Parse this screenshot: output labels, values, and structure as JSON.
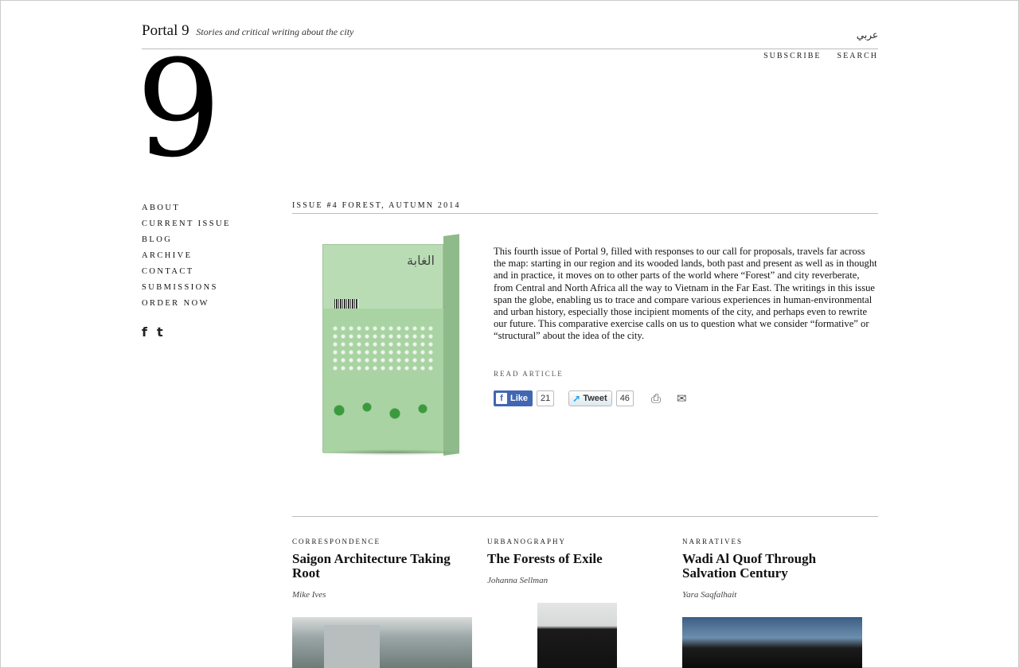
{
  "header": {
    "site_name": "Portal 9",
    "tagline": "Stories and critical writing about the city",
    "language_link": "عربي",
    "nav": [
      "SUBSCRIBE",
      "SEARCH"
    ],
    "logo_numeral": "9"
  },
  "sidebar": {
    "items": [
      {
        "label": "ABOUT"
      },
      {
        "label": "CURRENT ISSUE"
      },
      {
        "label": "BLOG"
      },
      {
        "label": "ARCHIVE"
      },
      {
        "label": "CONTACT"
      },
      {
        "label": "SUBMISSIONS"
      },
      {
        "label": "ORDER NOW"
      }
    ],
    "social": {
      "facebook": "f",
      "twitter": "t"
    }
  },
  "issue": {
    "heading": "ISSUE #4 FOREST, AUTUMN 2014",
    "book_title_arabic": "الغابة",
    "description": "This fourth issue of Portal 9, filled with responses to our call for proposals, travels far across the map: starting in our region and its wooded lands, both past and present as well as in thought and in practice, it moves on to other parts of the world where “Forest” and city reverberate, from Central and North Africa all the way to Vietnam in the Far East. The writings in this issue span the globe, enabling us to trace and compare various experiences in human-environmental and urban history, especially those incipient moments of the city, and perhaps even to rewrite our future. This comparative exercise calls on us to question what we consider “formative” or “structural” about the idea of the city.",
    "read_article": "READ ARTICLE",
    "share": {
      "like_label": "Like",
      "like_count": "21",
      "tweet_label": "Tweet",
      "tweet_count": "46"
    }
  },
  "articles": [
    {
      "category": "CORRESPONDENCE",
      "title": "Saigon Architecture Taking Root",
      "author": "Mike Ives"
    },
    {
      "category": "URBANOGRAPHY",
      "title": "The Forests of Exile",
      "author": "Johanna Sellman"
    },
    {
      "category": "NARRATIVES",
      "title": "Wadi Al Quof Through Salvation Century",
      "author": "Yara Saqfalhait"
    }
  ]
}
